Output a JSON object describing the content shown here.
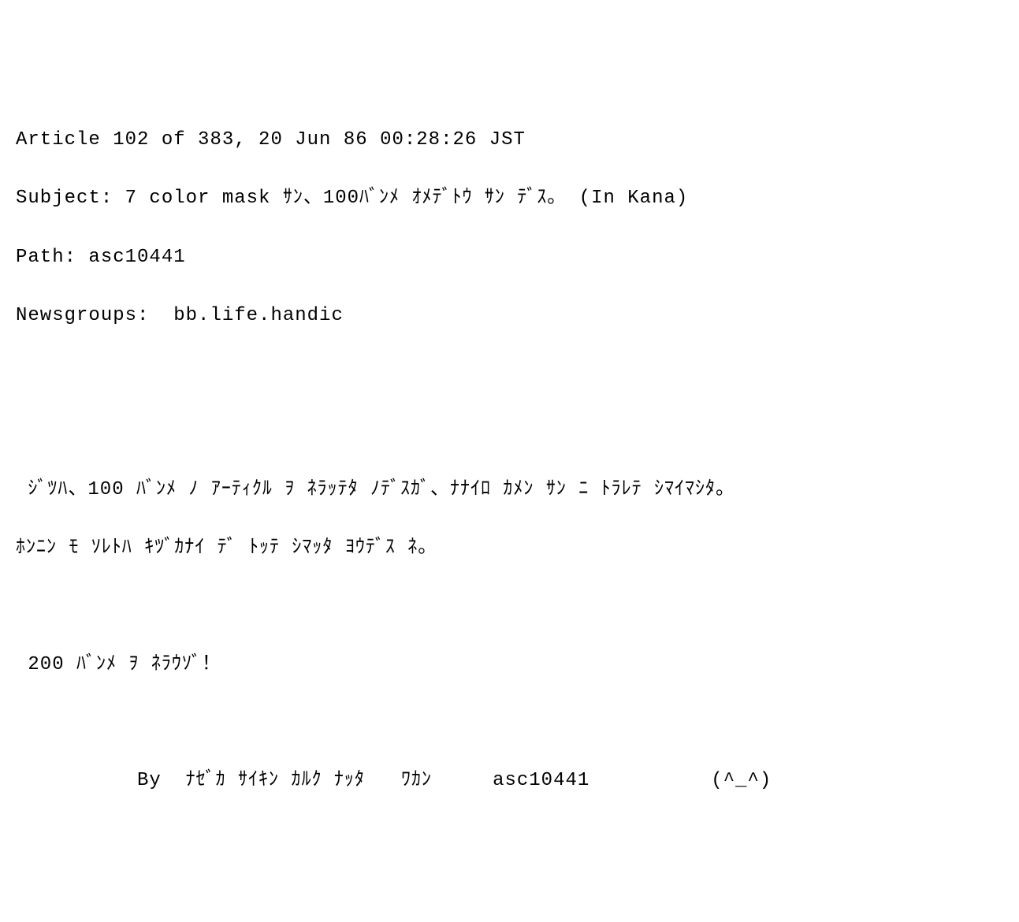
{
  "header": {
    "article_line": "Article 102 of 383, 20 Jun 86 00:28:26 JST",
    "subject_line": "Subject: 7 color mask ｻﾝ、100ﾊﾞﾝﾒ ｵﾒﾃﾞﾄｳ ｻﾝ ﾃﾞｽ。 (In Kana)",
    "path_line": "Path: asc10441",
    "newsgroups_line": "Newsgroups:  bb.life.handic"
  },
  "body": {
    "p1_l1": " ｼﾞﾂﾊ、100 ﾊﾞﾝﾒ ﾉ ｱｰﾃｨｸﾙ ｦ ﾈﾗｯﾃﾀ ﾉﾃﾞｽｶﾞ、ﾅﾅｲﾛ ｶﾒﾝ ｻﾝ ﾆ ﾄﾗﾚﾃ ｼﾏｲﾏｼﾀ。",
    "p1_l2": "ﾎﾝﾆﾝ ﾓ ｿﾚﾄﾊ ｷﾂﾞｶﾅｲ ﾃﾞ ﾄｯﾃ ｼﾏｯﾀ ﾖｳﾃﾞｽ ﾈ。",
    "p2": " 200 ﾊﾞﾝﾒ ｦ ﾈﾗｳｿﾞ！",
    "sig": "          By  ﾅｾﾞｶ ｻｲｷﾝ ｶﾙｸ ﾅｯﾀ   ﾜｶﾝ     asc10441          (^_^)"
  }
}
